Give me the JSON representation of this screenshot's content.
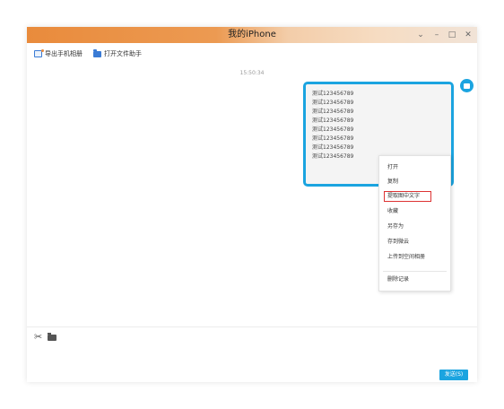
{
  "window": {
    "title": "我的iPhone",
    "controls": {
      "dropdown": "⌄",
      "minimize": "–",
      "maximize": "□",
      "close": "✕"
    }
  },
  "toolbar": {
    "export_photos": "导出手机相册",
    "open_file_assistant": "打开文件助手"
  },
  "chat": {
    "timestamp": "15:50:34",
    "message_lines": [
      "测试123456789",
      "测试123456789",
      "测试123456789",
      "测试123456789",
      "测试123456789",
      "测试123456789",
      "测试123456789",
      "测试123456789"
    ]
  },
  "context_menu": {
    "items": [
      "打开",
      "复制",
      "提取图中文字",
      "收藏",
      "另存为",
      "存到微云",
      "上传到空间相册",
      "删除记录"
    ],
    "highlighted_index": 2
  },
  "composer": {
    "send_label": "发送(S)"
  },
  "colors": {
    "accent": "#1ba4e0",
    "title_bar": "#e98b3c",
    "highlight_border": "#dd3333"
  }
}
